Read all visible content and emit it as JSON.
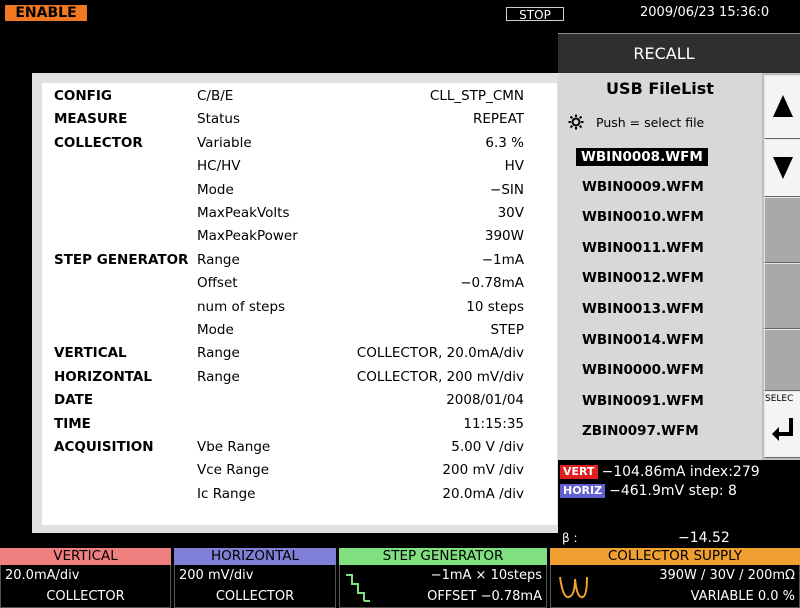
{
  "topbar": {
    "enable": "ENABLE",
    "stop": "STOP",
    "datetime": "2009/06/23 15:36:0"
  },
  "config": {
    "rows": [
      {
        "label": "CONFIG",
        "param": "C/B/E",
        "value": "CLL_STP_CMN"
      },
      {
        "label": "MEASURE",
        "param": "Status",
        "value": "REPEAT"
      },
      {
        "label": "COLLECTOR",
        "param": "Variable",
        "value": "6.3  %"
      },
      {
        "label": "",
        "param": "HC/HV",
        "value": "HV"
      },
      {
        "label": "",
        "param": "Mode",
        "value": "−SIN"
      },
      {
        "label": "",
        "param": "MaxPeakVolts",
        "value": "30V"
      },
      {
        "label": "",
        "param": "MaxPeakPower",
        "value": "390W"
      },
      {
        "label": "STEP  GENERATOR",
        "param": "Range",
        "value": "−1mA"
      },
      {
        "label": "",
        "param": "Offset",
        "value": "−0.78mA"
      },
      {
        "label": "",
        "param": "num  of  steps",
        "value": "10  steps"
      },
      {
        "label": "",
        "param": "Mode",
        "value": "STEP"
      },
      {
        "label": "VERTICAL",
        "param": "Range",
        "value": "COLLECTOR,  20.0mA/div"
      },
      {
        "label": "HORIZONTAL",
        "param": "Range",
        "value": "COLLECTOR,  200  mV/div"
      },
      {
        "label": "DATE",
        "param": "",
        "value": "2008/01/04"
      },
      {
        "label": "TIME",
        "param": "",
        "value": "11:15:35"
      },
      {
        "label": "ACQUISITION",
        "param": "Vbe  Range",
        "value": "5.00  V  /div"
      },
      {
        "label": "",
        "param": "Vce  Range",
        "value": "200  mV  /div"
      },
      {
        "label": "",
        "param": "Ic    Range",
        "value": "20.0mA  /div"
      }
    ]
  },
  "recall": {
    "header": "RECALL",
    "title": "USB FileList",
    "hint": "Push  =  select  file",
    "files": [
      "WBIN0008.WFM",
      "WBIN0009.WFM",
      "WBIN0010.WFM",
      "WBIN0011.WFM",
      "WBIN0012.WFM",
      "WBIN0013.WFM",
      "WBIN0014.WFM",
      "WBIN0000.WFM",
      "WBIN0091.WFM",
      "ZBIN0097.WFM"
    ],
    "selected_index": 0,
    "select_label": "SELEC"
  },
  "readouts": {
    "vert_tag": "VERT",
    "vert_value": "−104.86mA  index:279",
    "horiz_tag": "HORIZ",
    "horiz_value": "−461.9mV    step:   8",
    "beta_label": "β   :",
    "beta_value": "−14.52"
  },
  "bottom": {
    "vertical": {
      "title": "VERTICAL",
      "line1": "20.0mA/div",
      "line2": "COLLECTOR",
      "color": "#f08080"
    },
    "horizontal": {
      "title": "HORIZONTAL",
      "line1": "200  mV/div",
      "line2": "COLLECTOR",
      "color": "#8080d8"
    },
    "step": {
      "title": "STEP  GENERATOR",
      "line1": "−1mA  ×  10steps",
      "line2": "OFFSET    −0.78mA",
      "color": "#80e080"
    },
    "collector": {
      "title": "COLLECTOR  SUPPLY",
      "line1": "390W  /   30V   /  200mΩ",
      "line2": "VARIABLE          0.0  %",
      "color": "#f0a030"
    }
  },
  "colors": {
    "vert_tag": "#e02020",
    "horiz_tag": "#6060d0",
    "accent": "#f07820"
  }
}
